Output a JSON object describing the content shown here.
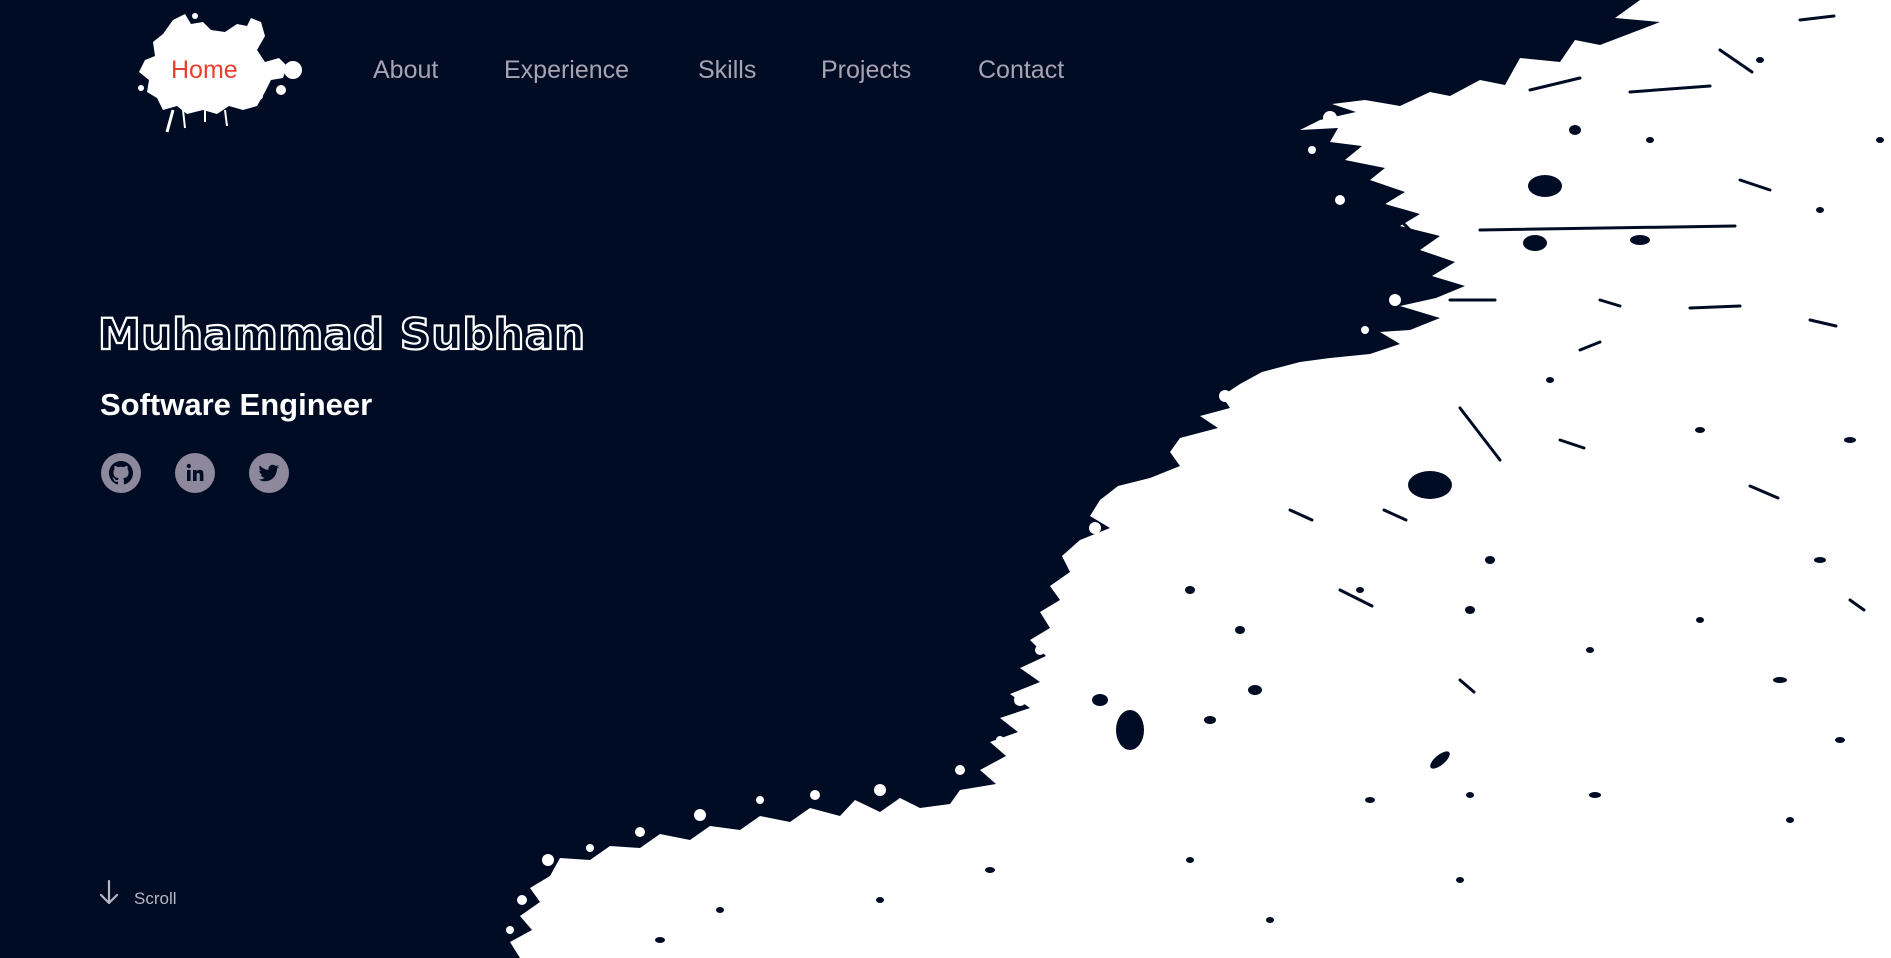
{
  "nav": {
    "items": [
      {
        "label": "Home",
        "active": true
      },
      {
        "label": "About",
        "active": false
      },
      {
        "label": "Experience",
        "active": false
      },
      {
        "label": "Skills",
        "active": false
      },
      {
        "label": "Projects",
        "active": false
      },
      {
        "label": "Contact",
        "active": false
      }
    ]
  },
  "hero": {
    "name": "Muhammad Subhan",
    "role": "Software Engineer",
    "socials": [
      {
        "icon": "github-icon"
      },
      {
        "icon": "linkedin-icon"
      },
      {
        "icon": "twitter-icon"
      }
    ]
  },
  "scroll": {
    "label": "Scroll",
    "icon": "arrow-down-icon"
  },
  "colors": {
    "background": "#000c24",
    "splash": "#ffffff",
    "accent": "#e8402f",
    "nav_text": "#a7a3b3",
    "social_icon_bg": "#8d889b"
  }
}
